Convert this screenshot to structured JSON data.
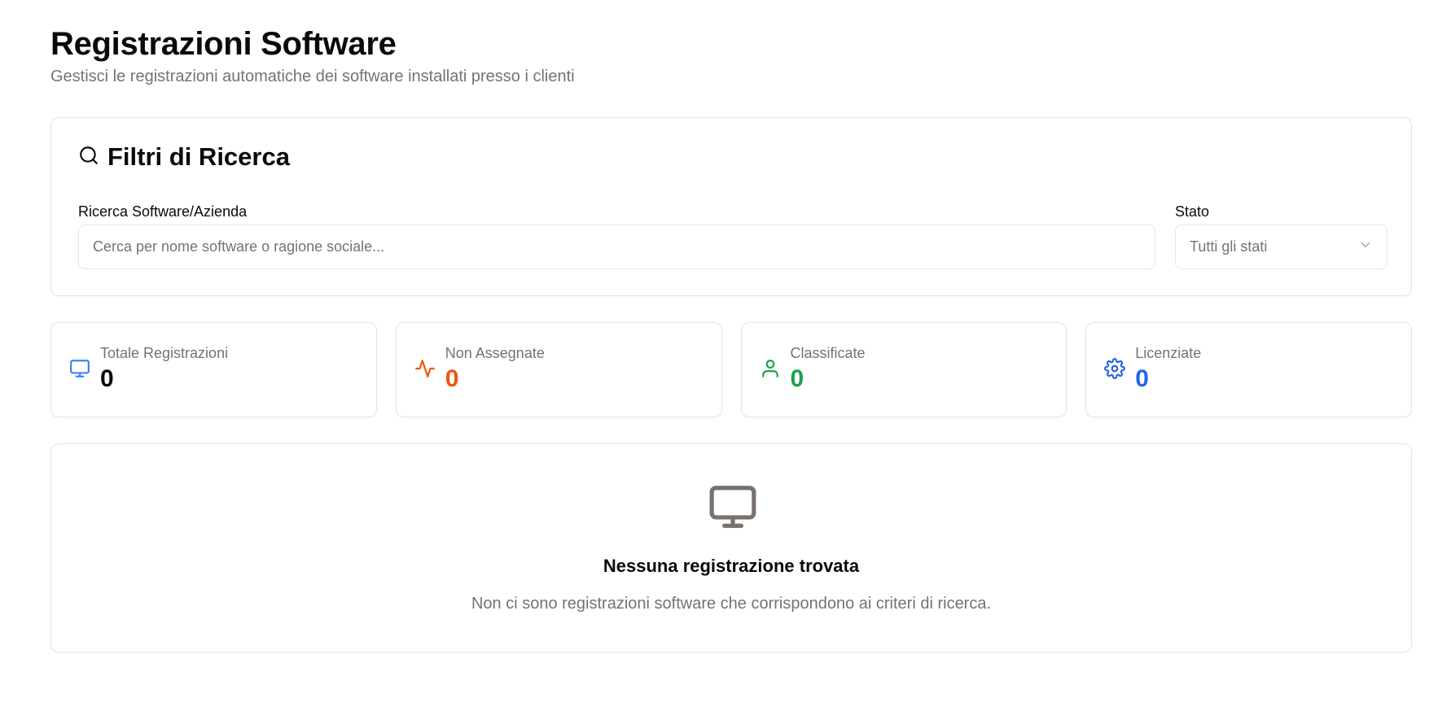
{
  "header": {
    "title": "Registrazioni Software",
    "subtitle": "Gestisci le registrazioni automatiche dei software installati presso i clienti"
  },
  "filters": {
    "title": "Filtri di Ricerca",
    "icon": "search-icon",
    "search": {
      "label": "Ricerca Software/Azienda",
      "placeholder": "Cerca per nome software o ragione sociale...",
      "value": ""
    },
    "status": {
      "label": "Stato",
      "selected": "Tutti gli stati",
      "icon": "chevron-down-icon"
    }
  },
  "stats": [
    {
      "label": "Totale Registrazioni",
      "value": "0",
      "icon": "monitor-icon",
      "color": "#3b82f6",
      "value_color": "#0a0a0a"
    },
    {
      "label": "Non Assegnate",
      "value": "0",
      "icon": "activity-icon",
      "color": "#ea580c",
      "value_color": "#ea580c"
    },
    {
      "label": "Classificate",
      "value": "0",
      "icon": "user-icon",
      "color": "#16a34a",
      "value_color": "#16a34a"
    },
    {
      "label": "Licenziate",
      "value": "0",
      "icon": "settings-icon",
      "color": "#2563eb",
      "value_color": "#2563eb"
    }
  ],
  "empty_state": {
    "icon": "monitor-icon",
    "title": "Nessuna registrazione trovata",
    "text": "Non ci sono registrazioni software che corrispondono ai criteri di ricerca."
  }
}
